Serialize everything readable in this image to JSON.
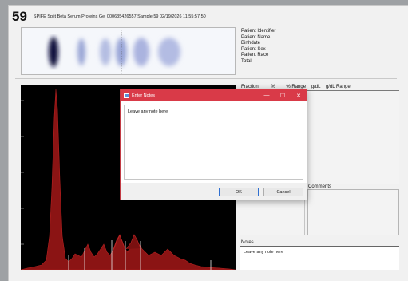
{
  "header": {
    "sample_number": "59",
    "info": "SPIFE Split Beta Serum Proteins  Gel 000635426557  Sample 59  02/19/2026  11:55:57:50"
  },
  "patient_fields": [
    "Patient Identifier",
    "Patient Name",
    "Birthdate",
    "Patient Sex",
    "Patient Race",
    "Total"
  ],
  "fractions": {
    "col1": "Fraction",
    "col2": "%",
    "col3": "% Range",
    "col4": "g/dL",
    "col5": "g/dL Range"
  },
  "comments_label": "Comments",
  "notes": {
    "label": "Notes",
    "text": "Leave any note here"
  },
  "dialog": {
    "title": "Enter Notes",
    "minimize": "—",
    "maximize": "☐",
    "close": "✕",
    "text": "Leave any note here",
    "ok_label": "OK",
    "cancel_label": "Cancel"
  },
  "colors": {
    "dialog_titlebar": "#d93a48",
    "densitometry_fill": "#8b1414",
    "gel_band": "#1a2a8a"
  }
}
